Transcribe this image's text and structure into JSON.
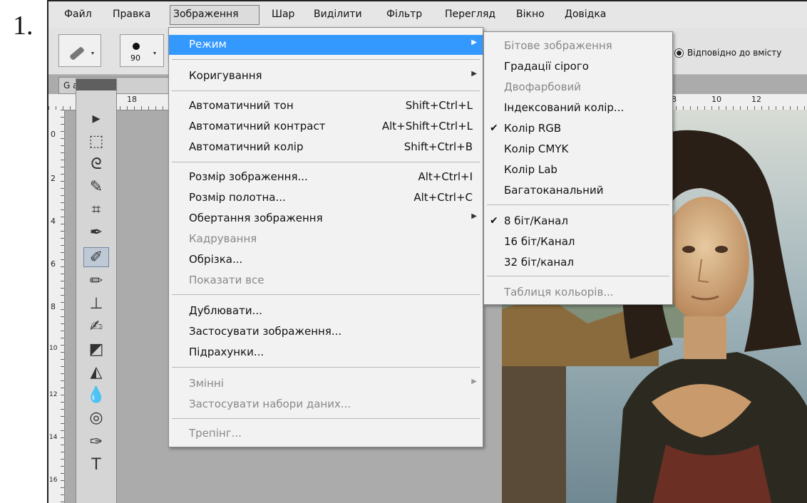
{
  "step_number": "1.",
  "menubar": {
    "items": [
      "Файл",
      "Правка",
      "Зображення",
      "Шар",
      "Виділити",
      "Фільтр",
      "Перегляд",
      "Вікно",
      "Довідка"
    ],
    "active_index": 2
  },
  "options_bar": {
    "brush_size": "90",
    "radio_label": "Відповідно до вмісту"
  },
  "document": {
    "tab_label": "G  a_(copia_c"
  },
  "rulers": {
    "top": [
      "18",
      "8",
      "10",
      "12"
    ],
    "left": [
      "0",
      "2",
      "4",
      "6",
      "8",
      "10",
      "12",
      "14",
      "16"
    ]
  },
  "image_menu": {
    "items": [
      {
        "label": "Режим",
        "shortcut": "",
        "submenu": true,
        "disabled": false,
        "highlighted": true
      },
      {
        "label": "Коригування",
        "shortcut": "",
        "submenu": true,
        "disabled": false
      },
      {
        "label": "Автоматичний тон",
        "shortcut": "Shift+Ctrl+L",
        "submenu": false,
        "disabled": false
      },
      {
        "label": "Автоматичний контраст",
        "shortcut": "Alt+Shift+Ctrl+L",
        "submenu": false,
        "disabled": false
      },
      {
        "label": "Автоматичний колір",
        "shortcut": "Shift+Ctrl+B",
        "submenu": false,
        "disabled": false
      },
      {
        "label": "Розмір зображення...",
        "shortcut": "Alt+Ctrl+I",
        "submenu": false,
        "disabled": false
      },
      {
        "label": "Розмір полотна...",
        "shortcut": "Alt+Ctrl+C",
        "submenu": false,
        "disabled": false
      },
      {
        "label": "Обертання зображення",
        "shortcut": "",
        "submenu": true,
        "disabled": false
      },
      {
        "label": "Кадрування",
        "shortcut": "",
        "submenu": false,
        "disabled": true
      },
      {
        "label": "Обрізка...",
        "shortcut": "",
        "submenu": false,
        "disabled": false
      },
      {
        "label": "Показати все",
        "shortcut": "",
        "submenu": false,
        "disabled": true
      },
      {
        "label": "Дублювати...",
        "shortcut": "",
        "submenu": false,
        "disabled": false
      },
      {
        "label": "Застосувати зображення...",
        "shortcut": "",
        "submenu": false,
        "disabled": false
      },
      {
        "label": "Підрахунки...",
        "shortcut": "",
        "submenu": false,
        "disabled": false
      },
      {
        "label": "Змінні",
        "shortcut": "",
        "submenu": true,
        "disabled": true
      },
      {
        "label": "Застосувати набори даних...",
        "shortcut": "",
        "submenu": false,
        "disabled": true
      },
      {
        "label": "Трепінг...",
        "shortcut": "",
        "submenu": false,
        "disabled": true
      }
    ]
  },
  "mode_submenu": {
    "items": [
      {
        "label": "Бітове зображення",
        "checked": false,
        "disabled": true
      },
      {
        "label": "Градації сірого",
        "checked": false,
        "disabled": false
      },
      {
        "label": "Двофарбовий",
        "checked": false,
        "disabled": true
      },
      {
        "label": "Індексований колір...",
        "checked": false,
        "disabled": false
      },
      {
        "label": "Колір RGB",
        "checked": true,
        "disabled": false
      },
      {
        "label": "Колір CMYK",
        "checked": false,
        "disabled": false
      },
      {
        "label": "Колір Lab",
        "checked": false,
        "disabled": false
      },
      {
        "label": "Багатоканальний",
        "checked": false,
        "disabled": false
      },
      {
        "label": "8 біт/Канал",
        "checked": true,
        "disabled": false
      },
      {
        "label": "16 біт/Канал",
        "checked": false,
        "disabled": false
      },
      {
        "label": "32 біт/канал",
        "checked": false,
        "disabled": false
      },
      {
        "label": "Таблиця кольорів...",
        "checked": false,
        "disabled": true
      }
    ]
  },
  "colors": {
    "highlight": "#3399ff",
    "disabled_text": "#888888"
  }
}
